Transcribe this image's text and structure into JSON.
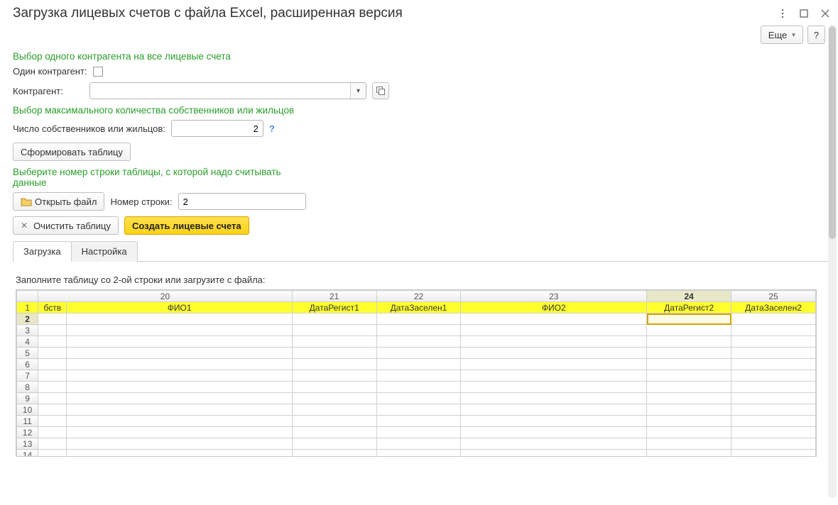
{
  "window": {
    "title": "Загрузка лицевых счетов с файла Excel, расширенная версия"
  },
  "toolbar": {
    "more_label": "Еще",
    "help_label": "?"
  },
  "section1": {
    "heading": "Выбор одного контрагента на все лицевые счета",
    "single_label": "Один контрагент:",
    "contragent_label": "Контрагент:",
    "contragent_value": ""
  },
  "section2": {
    "heading": "Выбор максимального количества собственников или жильцов",
    "count_label": "Число собственников или жильцов:",
    "count_value": "2"
  },
  "form_table_btn": "Сформировать таблицу",
  "section3": {
    "heading": "Выберите номер строки таблицы, с которой надо считывать данные",
    "open_file_btn": "Открыть файл",
    "row_label": "Номер строки:",
    "row_value": "2"
  },
  "clear_table_btn": "Очистить таблицу",
  "create_accounts_btn": "Создать лицевые счета",
  "tabs": {
    "load": "Загрузка",
    "settings": "Настройка"
  },
  "grid": {
    "hint": "Заполните таблицу со 2-ой строки или загрузите с файла:",
    "col_nums": [
      "20",
      "21",
      "22",
      "23",
      "24",
      "25"
    ],
    "header_row": [
      "бств",
      "ФИО1",
      "ДатаРегист1",
      "ДатаЗаселен1",
      "ФИО2",
      "ДатаРегист2",
      "ДатаЗаселен2"
    ],
    "selected_col_index": 4,
    "selected_row": 2,
    "row_count": 14
  }
}
